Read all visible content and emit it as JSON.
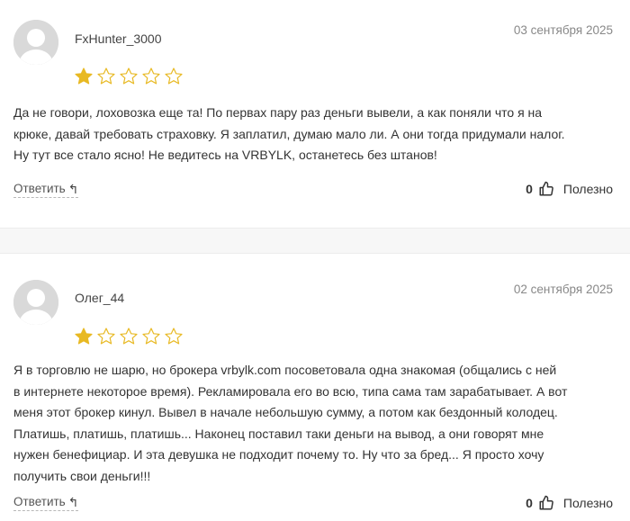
{
  "reviews": [
    {
      "author": "FxHunter_3000",
      "date": "03 сентября 2025",
      "rating": 1,
      "max_rating": 5,
      "text_lines": [
        "Да не говори, лоховозка еще та! По первах пару раз деньги вывели, а как поняли что я на",
        "крюке, давай требовать страховку. Я заплатил, думаю мало ли. А они тогда придумали налог.",
        "Ну тут все стало ясно! Не ведитесь на VRBYLK, останетесь без штанов!"
      ],
      "reply_label": "Ответить",
      "helpful_count": "0",
      "helpful_label": "Полезно"
    },
    {
      "author": "Олег_44",
      "date": "02 сентября 2025",
      "rating": 1,
      "max_rating": 5,
      "text_lines": [
        "Я в торговлю не шарю, но брокера vrbylk.com посоветовала одна знакомая (общались с ней",
        "в интернете некоторое время). Рекламировала его во всю, типа сама там зарабатывает. А вот",
        "меня этот брокер кинул. Вывел в начале небольшую сумму, а потом как бездонный колодец.",
        "Платишь, платишь, платишь... Наконец поставил таки деньги на вывод, а они говорят мне",
        "нужен бенефициар. И эта девушка не подходит почему то. Ну что за бред... Я просто хочу",
        "получить свои деньги!!!"
      ],
      "reply_label": "Ответить",
      "helpful_count": "0",
      "helpful_label": "Полезно"
    }
  ],
  "colors": {
    "star_filled": "#E8B923",
    "star_outline": "#E8B923",
    "avatar_bg": "#D9D9D9",
    "avatar_fg": "#FFFFFF",
    "date": "#888888"
  },
  "icons": {
    "avatar": "user-silhouette-icon",
    "star_filled": "star-filled-icon",
    "star_empty": "star-outline-icon",
    "reply": "reply-arrow-icon",
    "helpful": "thumbs-up-icon"
  }
}
